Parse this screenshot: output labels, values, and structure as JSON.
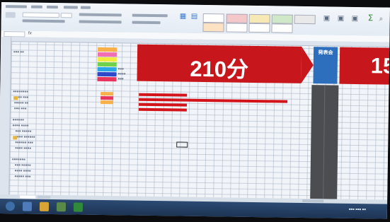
{
  "app": "Microsoft Excel",
  "banner": {
    "main_label": "210分",
    "blue_label": "発表会",
    "right_label": "15"
  },
  "legend": [
    {
      "color": "#f8b04a"
    },
    {
      "color": "#f26fb3"
    },
    {
      "color": "#f4ec3c"
    },
    {
      "color": "#6fd24a"
    },
    {
      "color": "#2aa5e6"
    },
    {
      "color": "#2f47c9"
    },
    {
      "color": "#e8355e"
    }
  ],
  "colors": {
    "banner_red": "#c7171d",
    "blue_header": "#2d6fbd",
    "dark_column": "#4b4d51",
    "ribbon": "#e3ebf4",
    "taskbar": "#1c3353"
  }
}
